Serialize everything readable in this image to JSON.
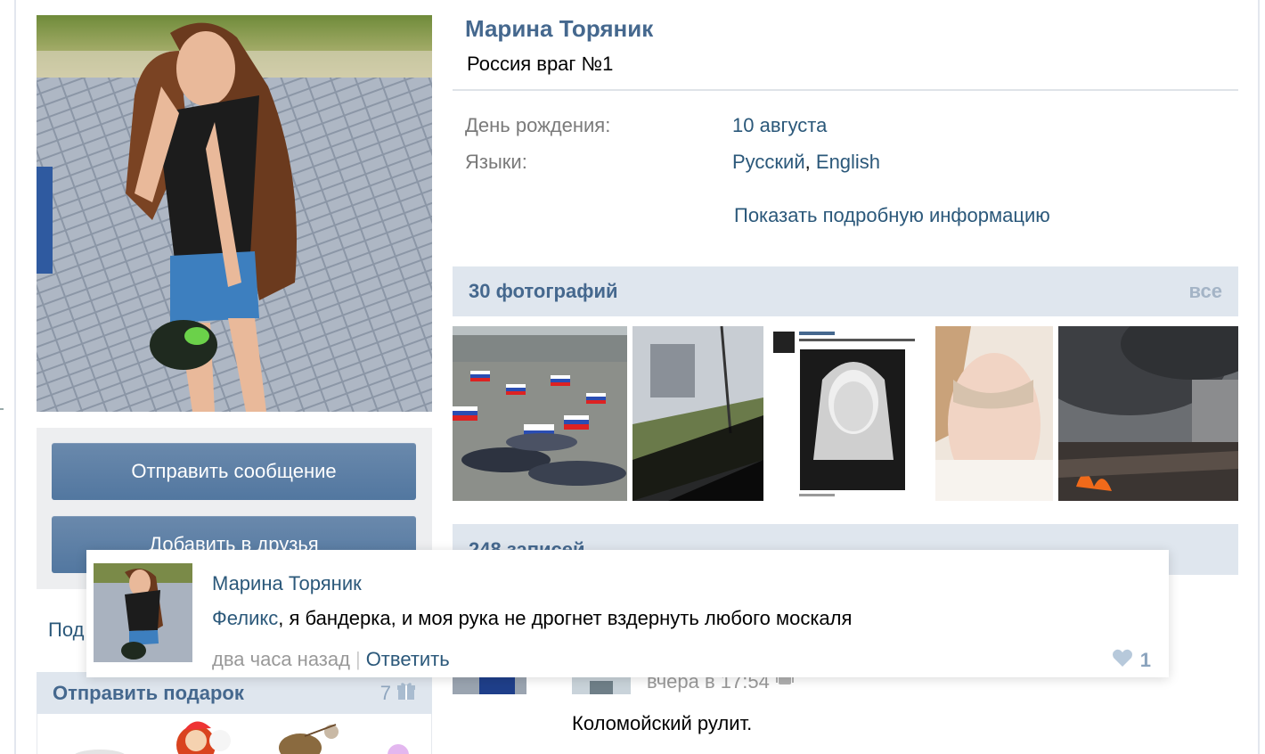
{
  "profile": {
    "name": "Марина Торяник",
    "status": "Россия враг №1",
    "info": {
      "birthday_label": "День рождения:",
      "birthday_value": "10 августа",
      "languages_label": "Языки:",
      "language_1": "Русский",
      "language_sep": ",",
      "language_2": "English",
      "show_more": "Показать подробную информацию"
    }
  },
  "actions": {
    "send_message": "Отправить сообщение",
    "add_friend": "Добавить в друзья",
    "subscribe_partial": "Под"
  },
  "gifts": {
    "title": "Отправить подарок",
    "count": "7"
  },
  "photos": {
    "title": "30 фотографий",
    "all_link": "все"
  },
  "wall": {
    "title": "248 записей",
    "post_time": "вчера в 17:54",
    "post_text": "Коломойский рулит."
  },
  "notification": {
    "author": "Марина Торяник",
    "mention": "Феликс",
    "text": ", я бандерка, и моя рука не дрогнет вздернуть любого москаля",
    "time": "два часа назад",
    "separator": "|",
    "reply": "Ответить",
    "likes": "1"
  },
  "icons": {
    "gift": "gift-icon",
    "heart": "heart-icon",
    "android": "android-icon"
  },
  "colors": {
    "link": "#2b587a",
    "header_bg": "#dfe6ee",
    "button_bg": "#5d7fa6"
  }
}
